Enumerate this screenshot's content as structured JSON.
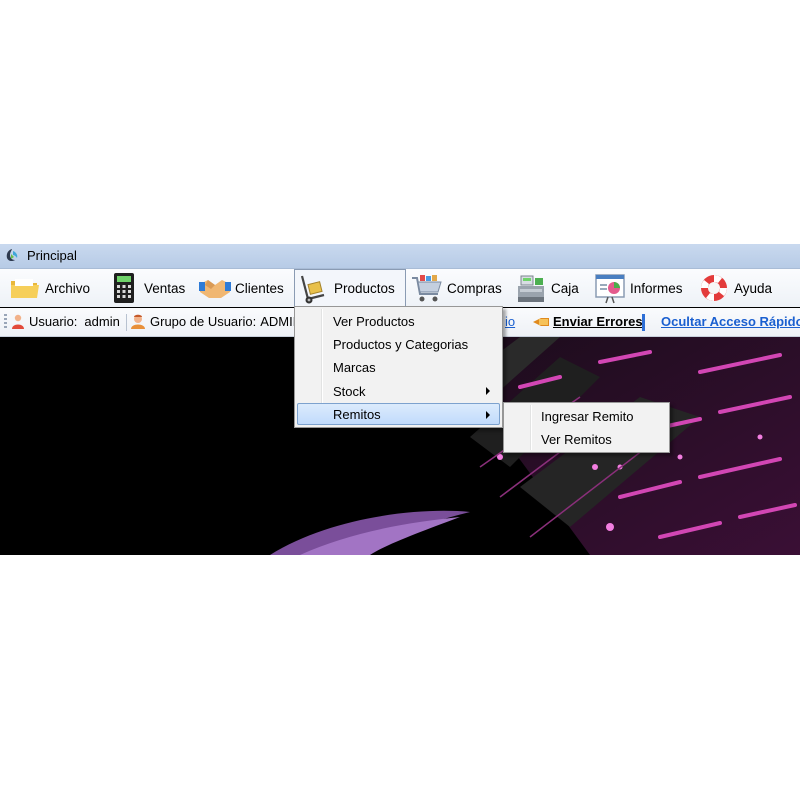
{
  "window": {
    "title": "Principal"
  },
  "menubar": [
    {
      "label": "Archivo",
      "icon": "folder-icon"
    },
    {
      "label": "Ventas",
      "icon": "calculator-icon"
    },
    {
      "label": "Clientes",
      "icon": "handshake-icon"
    },
    {
      "label": "Productos",
      "icon": "hand-truck-icon"
    },
    {
      "label": "Compras",
      "icon": "shopping-cart-icon"
    },
    {
      "label": "Caja",
      "icon": "cash-register-icon"
    },
    {
      "label": "Informes",
      "icon": "report-chart-icon"
    },
    {
      "label": "Ayuda",
      "icon": "lifebuoy-icon"
    }
  ],
  "statusbar": {
    "user_label": "Usuario:",
    "user_value": "admin",
    "group_label": "Grupo de Usuario:",
    "group_value": "ADMIN",
    "partial_link": "io",
    "send_errors": "Enviar Errores",
    "hide_quick_access": "Ocultar Acceso Rápido"
  },
  "productos_menu": [
    {
      "label": "Ver Productos",
      "has_submenu": false
    },
    {
      "label": "Productos y Categorias",
      "has_submenu": false
    },
    {
      "label": "Marcas",
      "has_submenu": false
    },
    {
      "label": "Stock",
      "has_submenu": true
    },
    {
      "label": "Remitos",
      "has_submenu": true,
      "highlighted": true
    }
  ],
  "remitos_submenu": [
    {
      "label": "Ingresar Remito"
    },
    {
      "label": "Ver Remitos"
    }
  ],
  "colors": {
    "titlebar": "#c9d9ef",
    "link_blue": "#1a5fd0",
    "menu_highlight": "#c1dbfc",
    "background_accent": "#c0409c"
  }
}
